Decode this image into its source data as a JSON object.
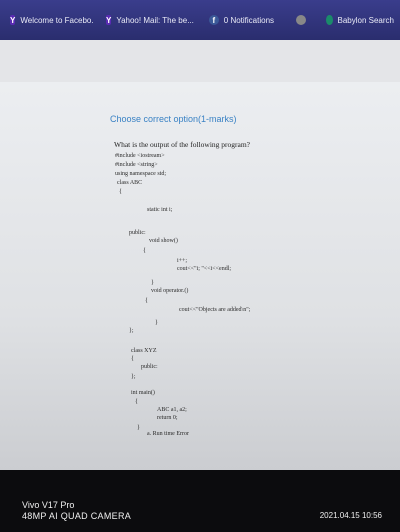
{
  "tabs": [
    {
      "label": "Welcome to Facebo...",
      "icon": "yahoo-icon"
    },
    {
      "label": "Yahoo! Mail: The be...",
      "icon": "yahoo-mail-icon"
    },
    {
      "label": "0 Notifications",
      "icon": "facebook-icon"
    },
    {
      "label": "",
      "icon": "globe-icon"
    },
    {
      "label": "Babylon Search",
      "icon": "babylon-icon"
    }
  ],
  "question": {
    "heading": "Choose correct option(1-marks)",
    "prompt": "What is the output of the following program?",
    "code": [
      "#include <iostream>",
      "#include <string>",
      "using namespace std;",
      "class ABC",
      "{",
      "static int i;",
      "public:",
      "void show()",
      "{",
      "i++;",
      "cout<<\"i; \"<<i<<endl;",
      "}",
      "void operator.()",
      "{",
      "cout<<\"Objects are added\\n\";",
      "}",
      "};",
      "class XYZ",
      "{",
      "public:",
      "};",
      "int main()",
      "{",
      "ABC a1, a2;",
      "return 0;",
      "}",
      "a.   Run time Error"
    ]
  },
  "watermark": {
    "device": "Vivo V17 Pro",
    "camera": "48MP AI QUAD CAMERA",
    "datetime": "2021.04.15 10:56"
  }
}
